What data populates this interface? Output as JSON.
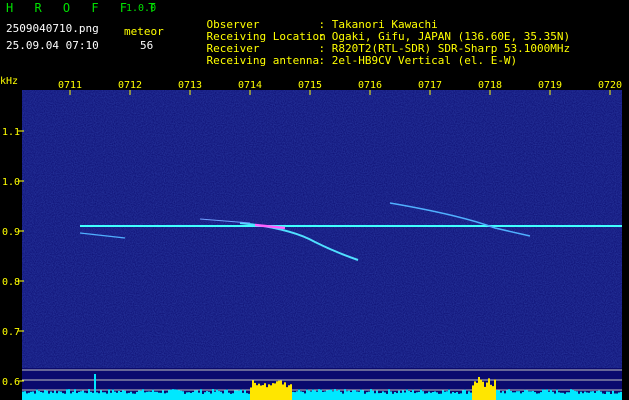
{
  "app": {
    "logo": "H R O F F T",
    "version": "1.0.0"
  },
  "file": {
    "name": "2509040710.png",
    "datetime": "25.09.04 07:10"
  },
  "meteor": {
    "label": "meteor",
    "count": "56"
  },
  "info": [
    {
      "label": "Observer",
      "sep": ":",
      "value": "Takanori Kawachi"
    },
    {
      "label": "Receiving Location",
      "sep": ":",
      "value": "Ogaki, Gifu, JAPAN (136.60E, 35.35N)"
    },
    {
      "label": "Receiver",
      "sep": ":",
      "value": "R820T2(RTL-SDR) SDR-Sharp 53.1000MHz"
    },
    {
      "label": "Receiving antenna",
      "sep": ":",
      "value": "2el-HB9CV Vertical (el. E-W)"
    }
  ],
  "axis": {
    "unit": "kHz",
    "times": [
      "0711",
      "0712",
      "0713",
      "0714",
      "0715",
      "0716",
      "0717",
      "0718",
      "0719",
      "0720"
    ],
    "freqs": [
      "1.1",
      "1.0",
      "0.9",
      "0.8",
      "0.7",
      "0.6"
    ]
  },
  "colors": {
    "bg": "#0a0a6e",
    "carrier": "#40ffff",
    "label": "#ffff00",
    "logo": "#00e000",
    "hist": "#00e8ff"
  }
}
